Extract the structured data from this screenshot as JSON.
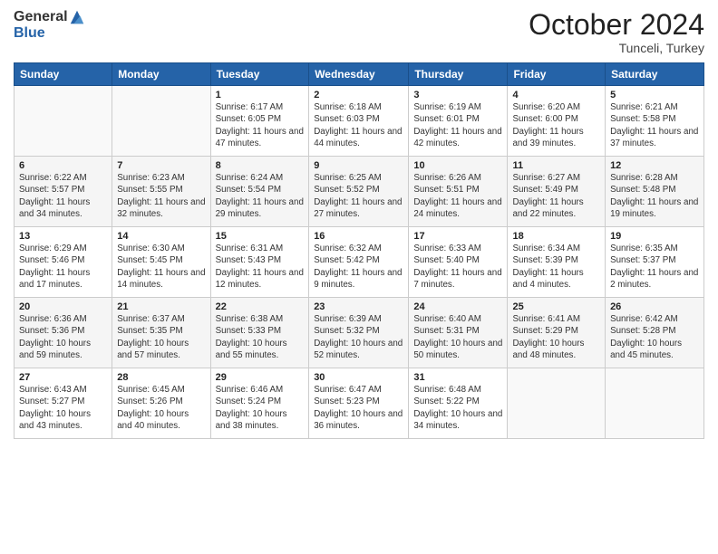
{
  "header": {
    "logo_general": "General",
    "logo_blue": "Blue",
    "title": "October 2024",
    "location": "Tunceli, Turkey"
  },
  "weekdays": [
    "Sunday",
    "Monday",
    "Tuesday",
    "Wednesday",
    "Thursday",
    "Friday",
    "Saturday"
  ],
  "weeks": [
    [
      {
        "day": "",
        "sunrise": "",
        "sunset": "",
        "daylight": ""
      },
      {
        "day": "",
        "sunrise": "",
        "sunset": "",
        "daylight": ""
      },
      {
        "day": "1",
        "sunrise": "Sunrise: 6:17 AM",
        "sunset": "Sunset: 6:05 PM",
        "daylight": "Daylight: 11 hours and 47 minutes."
      },
      {
        "day": "2",
        "sunrise": "Sunrise: 6:18 AM",
        "sunset": "Sunset: 6:03 PM",
        "daylight": "Daylight: 11 hours and 44 minutes."
      },
      {
        "day": "3",
        "sunrise": "Sunrise: 6:19 AM",
        "sunset": "Sunset: 6:01 PM",
        "daylight": "Daylight: 11 hours and 42 minutes."
      },
      {
        "day": "4",
        "sunrise": "Sunrise: 6:20 AM",
        "sunset": "Sunset: 6:00 PM",
        "daylight": "Daylight: 11 hours and 39 minutes."
      },
      {
        "day": "5",
        "sunrise": "Sunrise: 6:21 AM",
        "sunset": "Sunset: 5:58 PM",
        "daylight": "Daylight: 11 hours and 37 minutes."
      }
    ],
    [
      {
        "day": "6",
        "sunrise": "Sunrise: 6:22 AM",
        "sunset": "Sunset: 5:57 PM",
        "daylight": "Daylight: 11 hours and 34 minutes."
      },
      {
        "day": "7",
        "sunrise": "Sunrise: 6:23 AM",
        "sunset": "Sunset: 5:55 PM",
        "daylight": "Daylight: 11 hours and 32 minutes."
      },
      {
        "day": "8",
        "sunrise": "Sunrise: 6:24 AM",
        "sunset": "Sunset: 5:54 PM",
        "daylight": "Daylight: 11 hours and 29 minutes."
      },
      {
        "day": "9",
        "sunrise": "Sunrise: 6:25 AM",
        "sunset": "Sunset: 5:52 PM",
        "daylight": "Daylight: 11 hours and 27 minutes."
      },
      {
        "day": "10",
        "sunrise": "Sunrise: 6:26 AM",
        "sunset": "Sunset: 5:51 PM",
        "daylight": "Daylight: 11 hours and 24 minutes."
      },
      {
        "day": "11",
        "sunrise": "Sunrise: 6:27 AM",
        "sunset": "Sunset: 5:49 PM",
        "daylight": "Daylight: 11 hours and 22 minutes."
      },
      {
        "day": "12",
        "sunrise": "Sunrise: 6:28 AM",
        "sunset": "Sunset: 5:48 PM",
        "daylight": "Daylight: 11 hours and 19 minutes."
      }
    ],
    [
      {
        "day": "13",
        "sunrise": "Sunrise: 6:29 AM",
        "sunset": "Sunset: 5:46 PM",
        "daylight": "Daylight: 11 hours and 17 minutes."
      },
      {
        "day": "14",
        "sunrise": "Sunrise: 6:30 AM",
        "sunset": "Sunset: 5:45 PM",
        "daylight": "Daylight: 11 hours and 14 minutes."
      },
      {
        "day": "15",
        "sunrise": "Sunrise: 6:31 AM",
        "sunset": "Sunset: 5:43 PM",
        "daylight": "Daylight: 11 hours and 12 minutes."
      },
      {
        "day": "16",
        "sunrise": "Sunrise: 6:32 AM",
        "sunset": "Sunset: 5:42 PM",
        "daylight": "Daylight: 11 hours and 9 minutes."
      },
      {
        "day": "17",
        "sunrise": "Sunrise: 6:33 AM",
        "sunset": "Sunset: 5:40 PM",
        "daylight": "Daylight: 11 hours and 7 minutes."
      },
      {
        "day": "18",
        "sunrise": "Sunrise: 6:34 AM",
        "sunset": "Sunset: 5:39 PM",
        "daylight": "Daylight: 11 hours and 4 minutes."
      },
      {
        "day": "19",
        "sunrise": "Sunrise: 6:35 AM",
        "sunset": "Sunset: 5:37 PM",
        "daylight": "Daylight: 11 hours and 2 minutes."
      }
    ],
    [
      {
        "day": "20",
        "sunrise": "Sunrise: 6:36 AM",
        "sunset": "Sunset: 5:36 PM",
        "daylight": "Daylight: 10 hours and 59 minutes."
      },
      {
        "day": "21",
        "sunrise": "Sunrise: 6:37 AM",
        "sunset": "Sunset: 5:35 PM",
        "daylight": "Daylight: 10 hours and 57 minutes."
      },
      {
        "day": "22",
        "sunrise": "Sunrise: 6:38 AM",
        "sunset": "Sunset: 5:33 PM",
        "daylight": "Daylight: 10 hours and 55 minutes."
      },
      {
        "day": "23",
        "sunrise": "Sunrise: 6:39 AM",
        "sunset": "Sunset: 5:32 PM",
        "daylight": "Daylight: 10 hours and 52 minutes."
      },
      {
        "day": "24",
        "sunrise": "Sunrise: 6:40 AM",
        "sunset": "Sunset: 5:31 PM",
        "daylight": "Daylight: 10 hours and 50 minutes."
      },
      {
        "day": "25",
        "sunrise": "Sunrise: 6:41 AM",
        "sunset": "Sunset: 5:29 PM",
        "daylight": "Daylight: 10 hours and 48 minutes."
      },
      {
        "day": "26",
        "sunrise": "Sunrise: 6:42 AM",
        "sunset": "Sunset: 5:28 PM",
        "daylight": "Daylight: 10 hours and 45 minutes."
      }
    ],
    [
      {
        "day": "27",
        "sunrise": "Sunrise: 6:43 AM",
        "sunset": "Sunset: 5:27 PM",
        "daylight": "Daylight: 10 hours and 43 minutes."
      },
      {
        "day": "28",
        "sunrise": "Sunrise: 6:45 AM",
        "sunset": "Sunset: 5:26 PM",
        "daylight": "Daylight: 10 hours and 40 minutes."
      },
      {
        "day": "29",
        "sunrise": "Sunrise: 6:46 AM",
        "sunset": "Sunset: 5:24 PM",
        "daylight": "Daylight: 10 hours and 38 minutes."
      },
      {
        "day": "30",
        "sunrise": "Sunrise: 6:47 AM",
        "sunset": "Sunset: 5:23 PM",
        "daylight": "Daylight: 10 hours and 36 minutes."
      },
      {
        "day": "31",
        "sunrise": "Sunrise: 6:48 AM",
        "sunset": "Sunset: 5:22 PM",
        "daylight": "Daylight: 10 hours and 34 minutes."
      },
      {
        "day": "",
        "sunrise": "",
        "sunset": "",
        "daylight": ""
      },
      {
        "day": "",
        "sunrise": "",
        "sunset": "",
        "daylight": ""
      }
    ]
  ]
}
